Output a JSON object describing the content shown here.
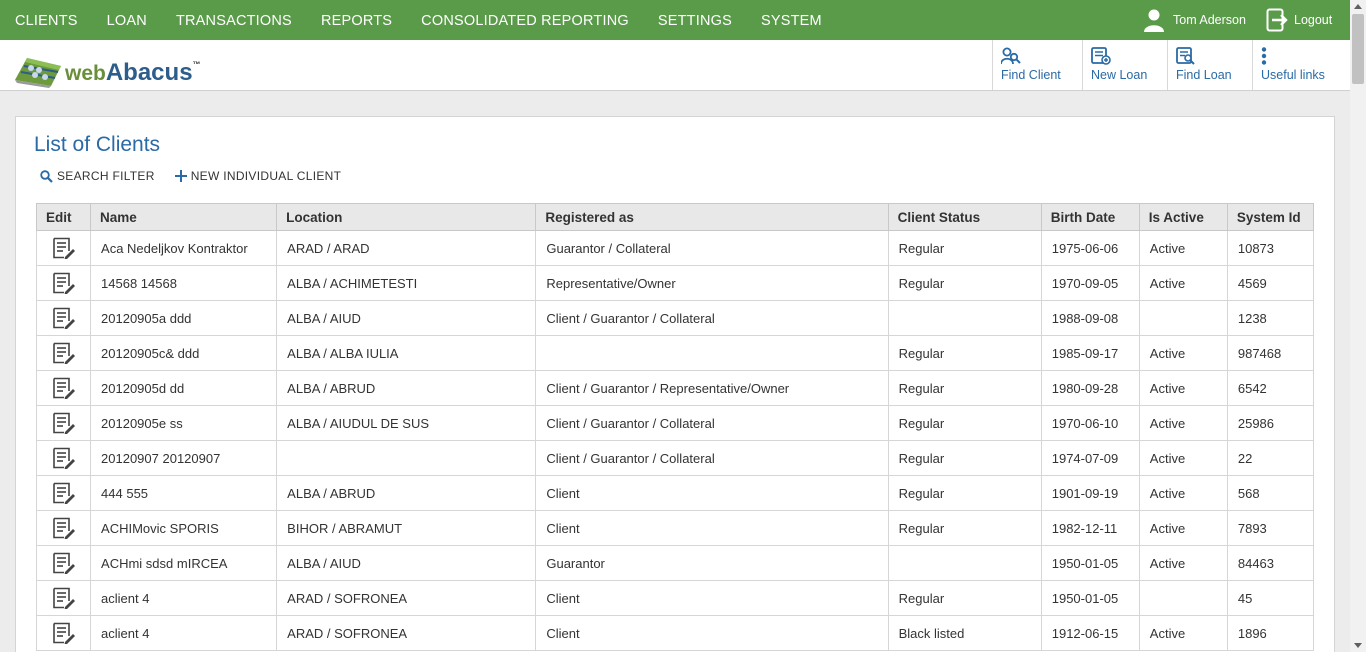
{
  "nav": {
    "menu": [
      "CLIENTS",
      "LOAN",
      "TRANSACTIONS",
      "REPORTS",
      "CONSOLIDATED REPORTING",
      "SETTINGS",
      "SYSTEM"
    ],
    "user_name": "Tom Aderson",
    "logout_label": "Logout"
  },
  "brand": {
    "part1": "web",
    "part2": "Abacus",
    "tm": "™"
  },
  "quick_links": [
    {
      "label": "Find Client",
      "icon": "find-client-icon"
    },
    {
      "label": "New Loan",
      "icon": "new-loan-icon"
    },
    {
      "label": "Find Loan",
      "icon": "find-loan-icon"
    },
    {
      "label": "Useful links",
      "icon": "more-vertical-icon"
    }
  ],
  "page": {
    "title": "List of Clients",
    "search_filter_label": "SEARCH FILTER",
    "new_client_label": "NEW INDIVIDUAL CLIENT"
  },
  "table": {
    "columns": [
      "Edit",
      "Name",
      "Location",
      "Registered as",
      "Client Status",
      "Birth Date",
      "Is Active",
      "System Id"
    ],
    "rows": [
      [
        "Aca Nedeljkov Kontraktor",
        "ARAD / ARAD",
        "Guarantor / Collateral",
        "Regular",
        "1975-06-06",
        "Active",
        "10873"
      ],
      [
        "14568 14568",
        "ALBA / ACHIMETESTI",
        "Representative/Owner",
        "Regular",
        "1970-09-05",
        "Active",
        "4569"
      ],
      [
        "20120905a ddd",
        "ALBA / AIUD",
        "Client / Guarantor / Collateral",
        "",
        "1988-09-08",
        "",
        "1238"
      ],
      [
        "20120905c& ddd",
        "ALBA / ALBA IULIA",
        "",
        "Regular",
        "1985-09-17",
        "Active",
        "987468"
      ],
      [
        "20120905d dd",
        "ALBA / ABRUD",
        "Client / Guarantor / Representative/Owner",
        "Regular",
        "1980-09-28",
        "Active",
        "6542"
      ],
      [
        "20120905e ss",
        "ALBA / AIUDUL DE SUS",
        "Client / Guarantor / Collateral",
        "Regular",
        "1970-06-10",
        "Active",
        "25986"
      ],
      [
        "20120907 20120907",
        "",
        "Client / Guarantor / Collateral",
        "Regular",
        "1974-07-09",
        "Active",
        "22"
      ],
      [
        "444 555",
        "ALBA / ABRUD",
        "Client",
        "Regular",
        "1901-09-19",
        "Active",
        "568"
      ],
      [
        "ACHIMovic SPORIS",
        "BIHOR / ABRAMUT",
        "Client",
        "Regular",
        "1982-12-11",
        "Active",
        "7893"
      ],
      [
        "ACHmi sdsd mIRCEA",
        "ALBA / AIUD",
        "Guarantor",
        "",
        "1950-01-05",
        "Active",
        "84463"
      ],
      [
        "aclient 4",
        "ARAD / SOFRONEA",
        "Client",
        "Regular",
        "1950-01-05",
        "",
        "45"
      ],
      [
        "aclient 4",
        "ARAD / SOFRONEA",
        "Client",
        "Black listed",
        "1912-06-15",
        "Active",
        "1896"
      ]
    ]
  },
  "colors": {
    "nav_green": "#5a9b4a",
    "link_blue": "#2a6aa6"
  }
}
